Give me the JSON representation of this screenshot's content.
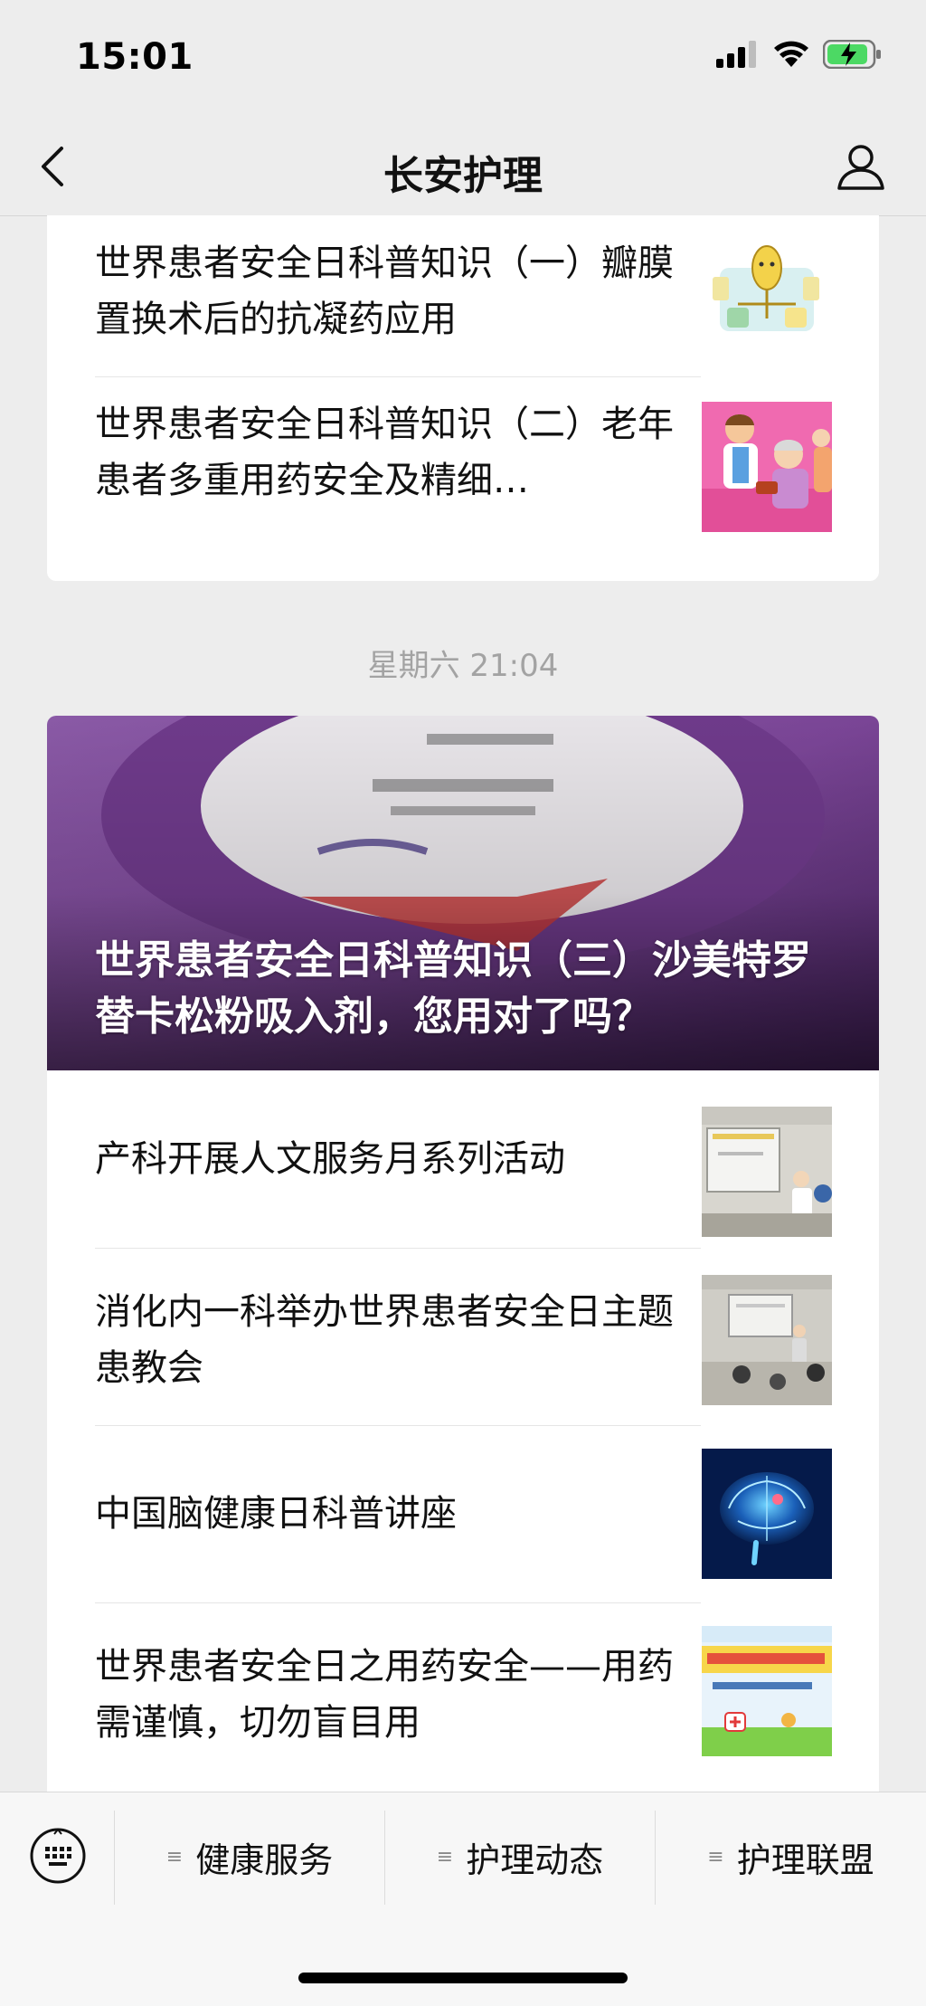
{
  "status_bar": {
    "time": "15:01"
  },
  "nav": {
    "title": "长安护理"
  },
  "top_card": {
    "articles": [
      {
        "title": "世界患者安全日科普知识（一）瓣膜置换术后的抗凝药应用"
      },
      {
        "title": "世界患者安全日科普知识（二）老年患者多重用药安全及精细…"
      }
    ]
  },
  "timestamp": "星期六 21:04",
  "main_card": {
    "hero_title": "世界患者安全日科普知识（三）沙美特罗替卡松粉吸入剂，您用对了吗？",
    "articles": [
      {
        "title": "产科开展人文服务月系列活动"
      },
      {
        "title": "消化内一科举办世界患者安全日主题患教会"
      },
      {
        "title": "中国脑健康日科普讲座"
      },
      {
        "title": "世界患者安全日之用药安全——用药需谨慎，切勿盲目用"
      }
    ]
  },
  "bottom_menu": {
    "items": [
      {
        "label": "健康服务",
        "icon": "menu-lines-icon"
      },
      {
        "label": "护理动态",
        "icon": "menu-lines-icon"
      },
      {
        "label": "护理联盟",
        "icon": "menu-lines-icon"
      }
    ]
  }
}
